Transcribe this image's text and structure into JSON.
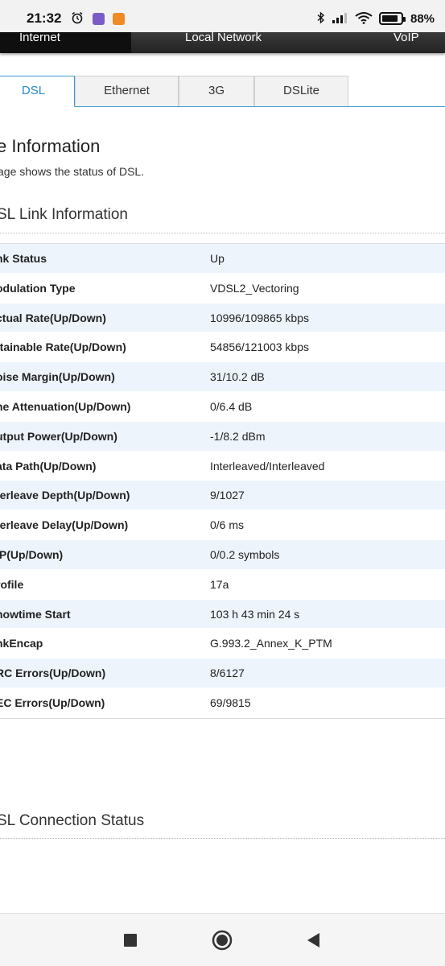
{
  "status_bar": {
    "time": "21:32",
    "battery_text": "88%",
    "battery_level": 0.88,
    "icons": [
      "alarm-icon",
      "viber-icon",
      "app-notification-icon",
      "bluetooth-icon",
      "signal-icon",
      "wifi-icon",
      "battery-icon"
    ]
  },
  "top_nav": {
    "items": [
      {
        "label": "Internet"
      },
      {
        "label": "Local Network"
      },
      {
        "label": "VoIP"
      }
    ]
  },
  "tabs": [
    {
      "label": "DSL",
      "active": true
    },
    {
      "label": "Ethernet"
    },
    {
      "label": "3G"
    },
    {
      "label": "DSLite"
    }
  ],
  "page": {
    "title": "e Information",
    "description": "age shows the status of DSL."
  },
  "link_section": {
    "title": "SL Link Information",
    "rows": [
      {
        "label": "nk Status",
        "value": "Up"
      },
      {
        "label": "odulation Type",
        "value": "VDSL2_Vectoring"
      },
      {
        "label": "ctual Rate(Up/Down)",
        "value": "10996/109865 kbps"
      },
      {
        "label": "ttainable Rate(Up/Down)",
        "value": "54856/121003 kbps"
      },
      {
        "label": "oise Margin(Up/Down)",
        "value": "31/10.2 dB"
      },
      {
        "label": "ne Attenuation(Up/Down)",
        "value": "0/6.4 dB"
      },
      {
        "label": "utput Power(Up/Down)",
        "value": "-1/8.2 dBm"
      },
      {
        "label": "ata Path(Up/Down)",
        "value": "Interleaved/Interleaved"
      },
      {
        "label": "terleave Depth(Up/Down)",
        "value": "9/1027"
      },
      {
        "label": "terleave Delay(Up/Down)",
        "value": "0/6 ms"
      },
      {
        "label": "IP(Up/Down)",
        "value": "0/0.2 symbols"
      },
      {
        "label": "rofile",
        "value": "17a"
      },
      {
        "label": "howtime Start",
        "value": "103 h 43 min 24 s"
      },
      {
        "label": "nkEncap",
        "value": "G.993.2_Annex_K_PTM"
      },
      {
        "label": "RC Errors(Up/Down)",
        "value": "8/6127"
      },
      {
        "label": "EC Errors(Up/Down)",
        "value": "69/9815"
      }
    ]
  },
  "connection_section": {
    "title": "SL Connection Status"
  },
  "colors": {
    "accent": "#2a8bc7",
    "row_stripe": "#eef4fb",
    "nav_bg": "#232323"
  }
}
